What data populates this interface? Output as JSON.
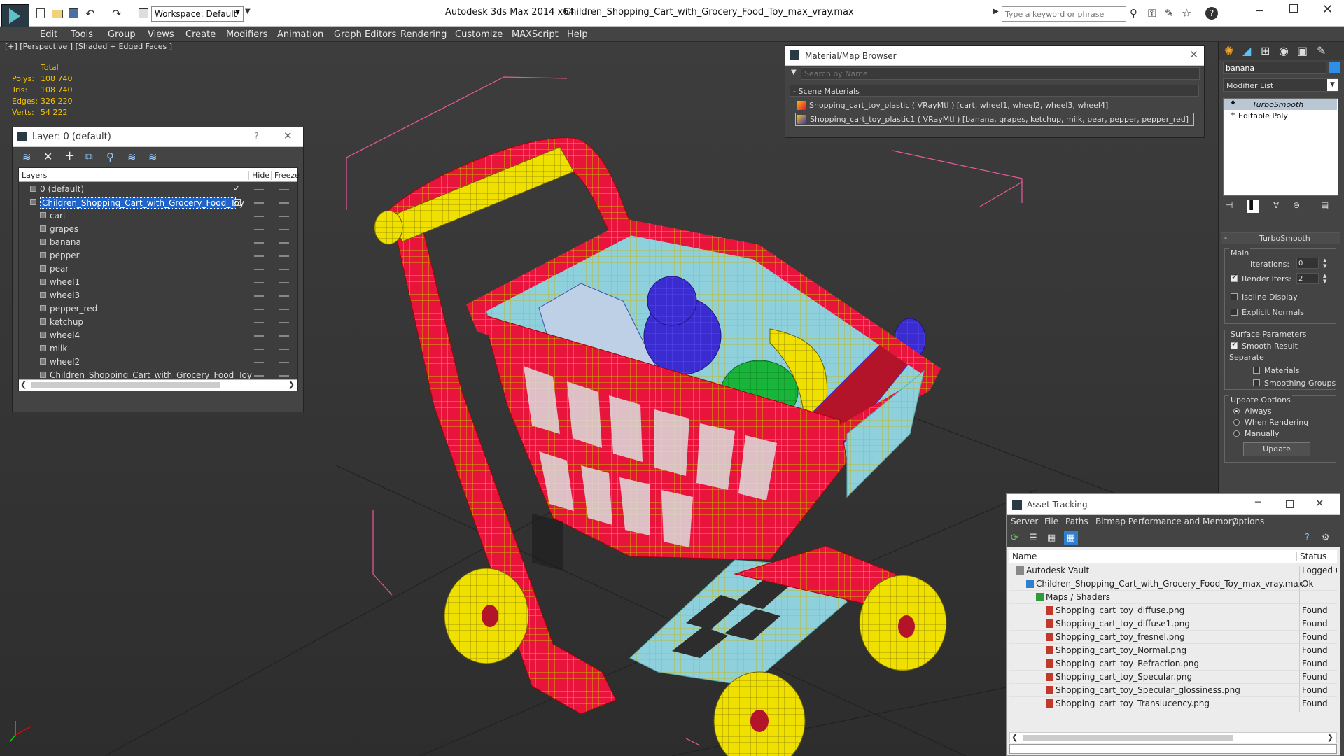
{
  "app": {
    "title": "Autodesk 3ds Max  2014 x64",
    "filename": "Children_Shopping_Cart_with_Grocery_Food_Toy_max_vray.max",
    "workspace": "Workspace: Default",
    "search_placeholder": "Type a keyword or phrase"
  },
  "menu": [
    "Edit",
    "Tools",
    "Group",
    "Views",
    "Create",
    "Modifiers",
    "Animation",
    "Graph Editors",
    "Rendering",
    "Customize",
    "MAXScript",
    "Help"
  ],
  "viewport": {
    "label": "[+] [Perspective ] [Shaded + Edged Faces ]",
    "stats": {
      "header": "Total",
      "rows": [
        {
          "label": "Polys:",
          "value": "108 740"
        },
        {
          "label": "Tris:",
          "value": "108 740"
        },
        {
          "label": "Edges:",
          "value": "326 220"
        },
        {
          "label": "Verts:",
          "value": "54 222"
        }
      ]
    }
  },
  "layer_panel": {
    "title": "Layer: 0 (default)",
    "help": "?",
    "col_layers": "Layers",
    "col_hide": "Hide",
    "col_freeze": "Freeze",
    "items": [
      {
        "name": "0 (default)",
        "level": 0
      },
      {
        "name": "Children_Shopping_Cart_with_Grocery_Food_Toy",
        "level": 0,
        "selected": true
      },
      {
        "name": "cart",
        "level": 1
      },
      {
        "name": "grapes",
        "level": 1
      },
      {
        "name": "banana",
        "level": 1
      },
      {
        "name": "pepper",
        "level": 1
      },
      {
        "name": "pear",
        "level": 1
      },
      {
        "name": "wheel1",
        "level": 1
      },
      {
        "name": "wheel3",
        "level": 1
      },
      {
        "name": "pepper_red",
        "level": 1
      },
      {
        "name": "ketchup",
        "level": 1
      },
      {
        "name": "wheel4",
        "level": 1
      },
      {
        "name": "milk",
        "level": 1
      },
      {
        "name": "wheel2",
        "level": 1
      },
      {
        "name": "Children_Shopping_Cart_with_Grocery_Food_Toy",
        "level": 1
      }
    ]
  },
  "material_browser": {
    "title": "Material/Map Browser",
    "search_placeholder": "Search by Name ...",
    "section": "- Scene Materials",
    "items": [
      "Shopping_cart_toy_plastic  ( VRayMtl ) [cart, wheel1, wheel2, wheel3, wheel4]",
      "Shopping_cart_toy_plastic1  ( VRayMtl ) [banana, grapes, ketchup, milk, pear, pepper, pepper_red]"
    ]
  },
  "command_panel": {
    "object_name": "banana",
    "modifier_list": "Modifier List",
    "stack": [
      "TurboSmooth",
      "Editable Poly"
    ],
    "rollout_title": "TurboSmooth",
    "main_label": "Main",
    "iterations_label": "Iterations:",
    "iterations_value": "0",
    "render_iters_label": "Render Iters:",
    "render_iters_value": "2",
    "isoline": "Isoline Display",
    "explicit_normals": "Explicit Normals",
    "surface_params": "Surface Parameters",
    "smooth_result": "Smooth Result",
    "separate": "Separate",
    "materials": "Materials",
    "smoothing_groups": "Smoothing Groups",
    "update_options": "Update Options",
    "always": "Always",
    "when_rendering": "When Rendering",
    "manually": "Manually",
    "update_button": "Update"
  },
  "asset_tracking": {
    "title": "Asset Tracking",
    "menu": [
      "Server",
      "File",
      "Paths",
      "Bitmap Performance and Memory",
      "Options"
    ],
    "col_name": "Name",
    "col_status": "Status",
    "rows": [
      {
        "name": "Autodesk Vault",
        "status": "Logged O",
        "indent": 0
      },
      {
        "name": "Children_Shopping_Cart_with_Grocery_Food_Toy_max_vray.max",
        "status": "Ok",
        "indent": 1
      },
      {
        "name": "Maps / Shaders",
        "status": "",
        "indent": 2
      },
      {
        "name": "Shopping_cart_toy_diffuse.png",
        "status": "Found",
        "indent": 3
      },
      {
        "name": "Shopping_cart_toy_diffuse1.png",
        "status": "Found",
        "indent": 3
      },
      {
        "name": "Shopping_cart_toy_fresnel.png",
        "status": "Found",
        "indent": 3
      },
      {
        "name": "Shopping_cart_toy_Normal.png",
        "status": "Found",
        "indent": 3
      },
      {
        "name": "Shopping_cart_toy_Refraction.png",
        "status": "Found",
        "indent": 3
      },
      {
        "name": "Shopping_cart_toy_Specular.png",
        "status": "Found",
        "indent": 3
      },
      {
        "name": "Shopping_cart_toy_Specular_glossiness.png",
        "status": "Found",
        "indent": 3
      },
      {
        "name": "Shopping_cart_toy_Translucency.png",
        "status": "Found",
        "indent": 3
      }
    ]
  },
  "colors": {
    "cart_red": "#e8143c",
    "wire_yellow": "#d4c400",
    "basket_blue": "#8fd0dd",
    "selection_blue": "#1e64c8",
    "stats_yellow": "#f4c400"
  }
}
